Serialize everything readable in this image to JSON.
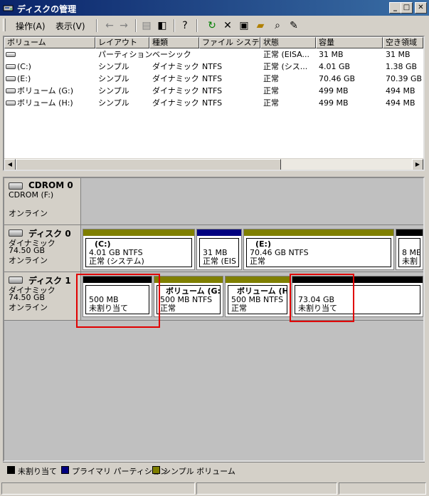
{
  "window": {
    "title": "ディスクの管理"
  },
  "menu": [
    "操作(A)",
    "表示(V)"
  ],
  "toolbar": {
    "icons": [
      "back-arrow-icon",
      "forward-arrow-icon",
      "folder-up-icon",
      "console-tree-icon",
      "help-icon",
      "refresh-icon",
      "delete-icon",
      "properties-icon",
      "open-icon",
      "explore-icon",
      "help-topics-icon"
    ]
  },
  "volume_list": {
    "columns": [
      "ボリューム",
      "レイアウト",
      "種類",
      "ファイル システ...",
      "状態",
      "容量",
      "空き領域"
    ],
    "rows": [
      [
        "",
        "パーティション",
        "ベーシック",
        "",
        "正常 (EISA...",
        "31 MB",
        "31 MB"
      ],
      [
        "(C:)",
        "シンプル",
        "ダイナミック",
        "NTFS",
        "正常 (シス...",
        "4.01 GB",
        "1.38 GB"
      ],
      [
        "(E:)",
        "シンプル",
        "ダイナミック",
        "NTFS",
        "正常",
        "70.46 GB",
        "70.39 GB"
      ],
      [
        "ボリューム (G:)",
        "シンプル",
        "ダイナミック",
        "NTFS",
        "正常",
        "499 MB",
        "494 MB"
      ],
      [
        "ボリューム (H:)",
        "シンプル",
        "ダイナミック",
        "NTFS",
        "正常",
        "499 MB",
        "494 MB"
      ]
    ]
  },
  "disks": [
    {
      "name": "CDROM 0",
      "lines": [
        "CDROM (F:)",
        "",
        "オンライン"
      ],
      "partitions": []
    },
    {
      "name": "ディスク 0",
      "lines": [
        "ダイナミック",
        "74.50 GB",
        "オンライン"
      ],
      "partitions": [
        {
          "title": "(C:)",
          "l1": "4.01 GB NTFS",
          "l2": "正常 (システム)",
          "type": "simple"
        },
        {
          "title": "",
          "l1": "31 MB",
          "l2": "正常 (EIS",
          "type": "primary"
        },
        {
          "title": "(E:)",
          "l1": "70.46 GB NTFS",
          "l2": "正常",
          "type": "simple"
        },
        {
          "title": "",
          "l1": "8 ME",
          "l2": "未割",
          "type": "unallocated"
        }
      ]
    },
    {
      "name": "ディスク 1",
      "lines": [
        "ダイナミック",
        "74.50 GB",
        "オンライン"
      ],
      "partitions": [
        {
          "title": "",
          "l1": "500 MB",
          "l2": "未割り当て",
          "type": "unallocated"
        },
        {
          "title": "ボリューム (G:)",
          "l1": "500 MB NTFS",
          "l2": "正常",
          "type": "simple"
        },
        {
          "title": "ボリューム (H:)",
          "l1": "500 MB NTFS",
          "l2": "正常",
          "type": "simple"
        },
        {
          "title": "",
          "l1": "73.04 GB",
          "l2": "未割り当て",
          "type": "unallocated"
        }
      ]
    }
  ],
  "legend": [
    {
      "label": "未割り当て",
      "color": "#000000"
    },
    {
      "label": "プライマリ パーティション",
      "color": "#00007f"
    },
    {
      "label": "シンプル ボリューム",
      "color": "#7f7f00"
    }
  ],
  "colors": {
    "unallocated": "#000000",
    "primary": "#00007f",
    "simple": "#7f7f00",
    "highlight": "#e00000",
    "titlebar": "#0a246a"
  }
}
